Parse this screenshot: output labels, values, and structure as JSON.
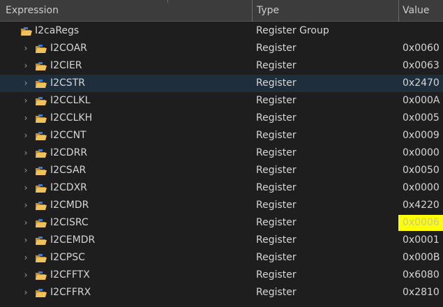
{
  "header": {
    "expression_label": "Expression",
    "type_label": "Type",
    "value_label": "Value"
  },
  "colors": {
    "background": "#1e1e1e",
    "header_background": "#3c3c3c",
    "selected_row": "#1f2e3c",
    "changed_value_highlight": "#ffff00",
    "folder_icon": "#d9a53a"
  },
  "icons": {
    "expand": "chevron-right-icon",
    "register": "register-folder-icon"
  },
  "group": {
    "name": "I2caRegs",
    "type": "Register Group"
  },
  "registers": [
    {
      "name": "I2COAR",
      "type": "Register",
      "value": "0x0060"
    },
    {
      "name": "I2CIER",
      "type": "Register",
      "value": "0x0063"
    },
    {
      "name": "I2CSTR",
      "type": "Register",
      "value": "0x2470",
      "selected": true
    },
    {
      "name": "I2CCLKL",
      "type": "Register",
      "value": "0x000A"
    },
    {
      "name": "I2CCLKH",
      "type": "Register",
      "value": "0x0005"
    },
    {
      "name": "I2CCNT",
      "type": "Register",
      "value": "0x0009"
    },
    {
      "name": "I2CDRR",
      "type": "Register",
      "value": "0x0000"
    },
    {
      "name": "I2CSAR",
      "type": "Register",
      "value": "0x0050"
    },
    {
      "name": "I2CDXR",
      "type": "Register",
      "value": "0x0000"
    },
    {
      "name": "I2CMDR",
      "type": "Register",
      "value": "0x4220"
    },
    {
      "name": "I2CISRC",
      "type": "Register",
      "value": "0x0006",
      "changed": true
    },
    {
      "name": "I2CEMDR",
      "type": "Register",
      "value": "0x0001"
    },
    {
      "name": "I2CPSC",
      "type": "Register",
      "value": "0x000B"
    },
    {
      "name": "I2CFFTX",
      "type": "Register",
      "value": "0x6080"
    },
    {
      "name": "I2CFFRX",
      "type": "Register",
      "value": "0x2810"
    }
  ]
}
